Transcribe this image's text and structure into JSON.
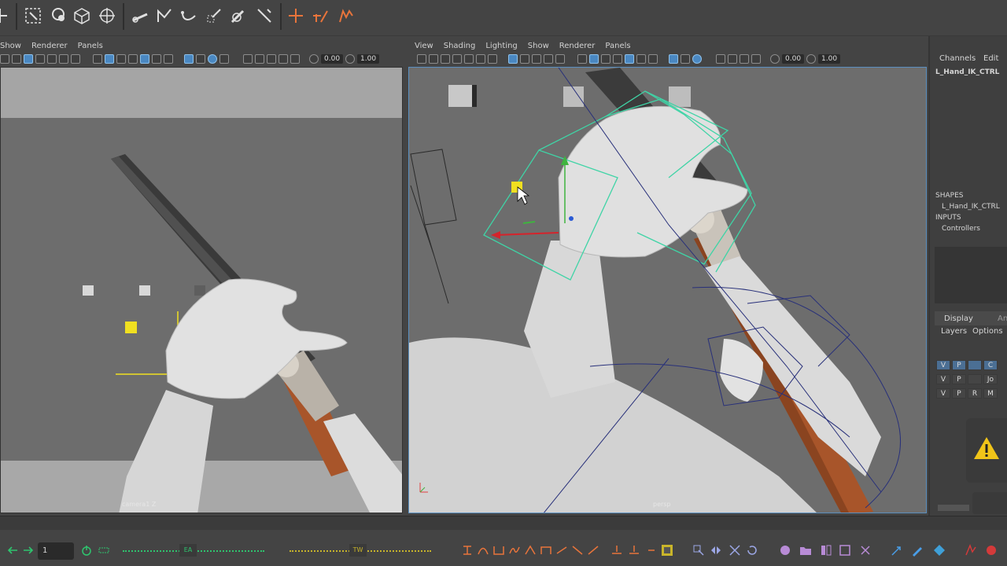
{
  "left_panel": {
    "menu": [
      "Show",
      "Renderer",
      "Panels"
    ],
    "near_clip": "0.00",
    "far_clip": "1.00",
    "camera_label": "camera1 Z"
  },
  "right_panel": {
    "menu": [
      "View",
      "Shading",
      "Lighting",
      "Show",
      "Renderer",
      "Panels"
    ],
    "near_clip": "0.00",
    "far_clip": "1.00",
    "camera_label": "persp"
  },
  "channel_box": {
    "tabs": [
      "Channels",
      "Edit"
    ],
    "object_name": "L_Hand_IK_CTRL",
    "shapes_header": "SHAPES",
    "shape_name": "L_Hand_IK_CTRL",
    "inputs_header": "INPUTS",
    "input_name": "Controllers"
  },
  "layer_editor": {
    "tabs": [
      "Display",
      "Anim"
    ],
    "menu": [
      "Layers",
      "Options"
    ],
    "layers": [
      {
        "v": "V",
        "p": "P",
        "r": "",
        "name": "C",
        "selected": true
      },
      {
        "v": "V",
        "p": "P",
        "r": "",
        "name": "Jo",
        "selected": false
      },
      {
        "v": "V",
        "p": "P",
        "r": "R",
        "name": "M",
        "selected": false
      }
    ]
  },
  "bottom": {
    "current_frame": "1",
    "ea_label": "EA",
    "tw_label": "TW"
  },
  "colors": {
    "accent_orange": "#e8743b",
    "selection_blue": "#4a88c2",
    "wire_green": "#3fd4a6",
    "wire_blue": "#28307a",
    "rifle_wood": "#a8552a",
    "warning_yellow": "#f0c419"
  }
}
